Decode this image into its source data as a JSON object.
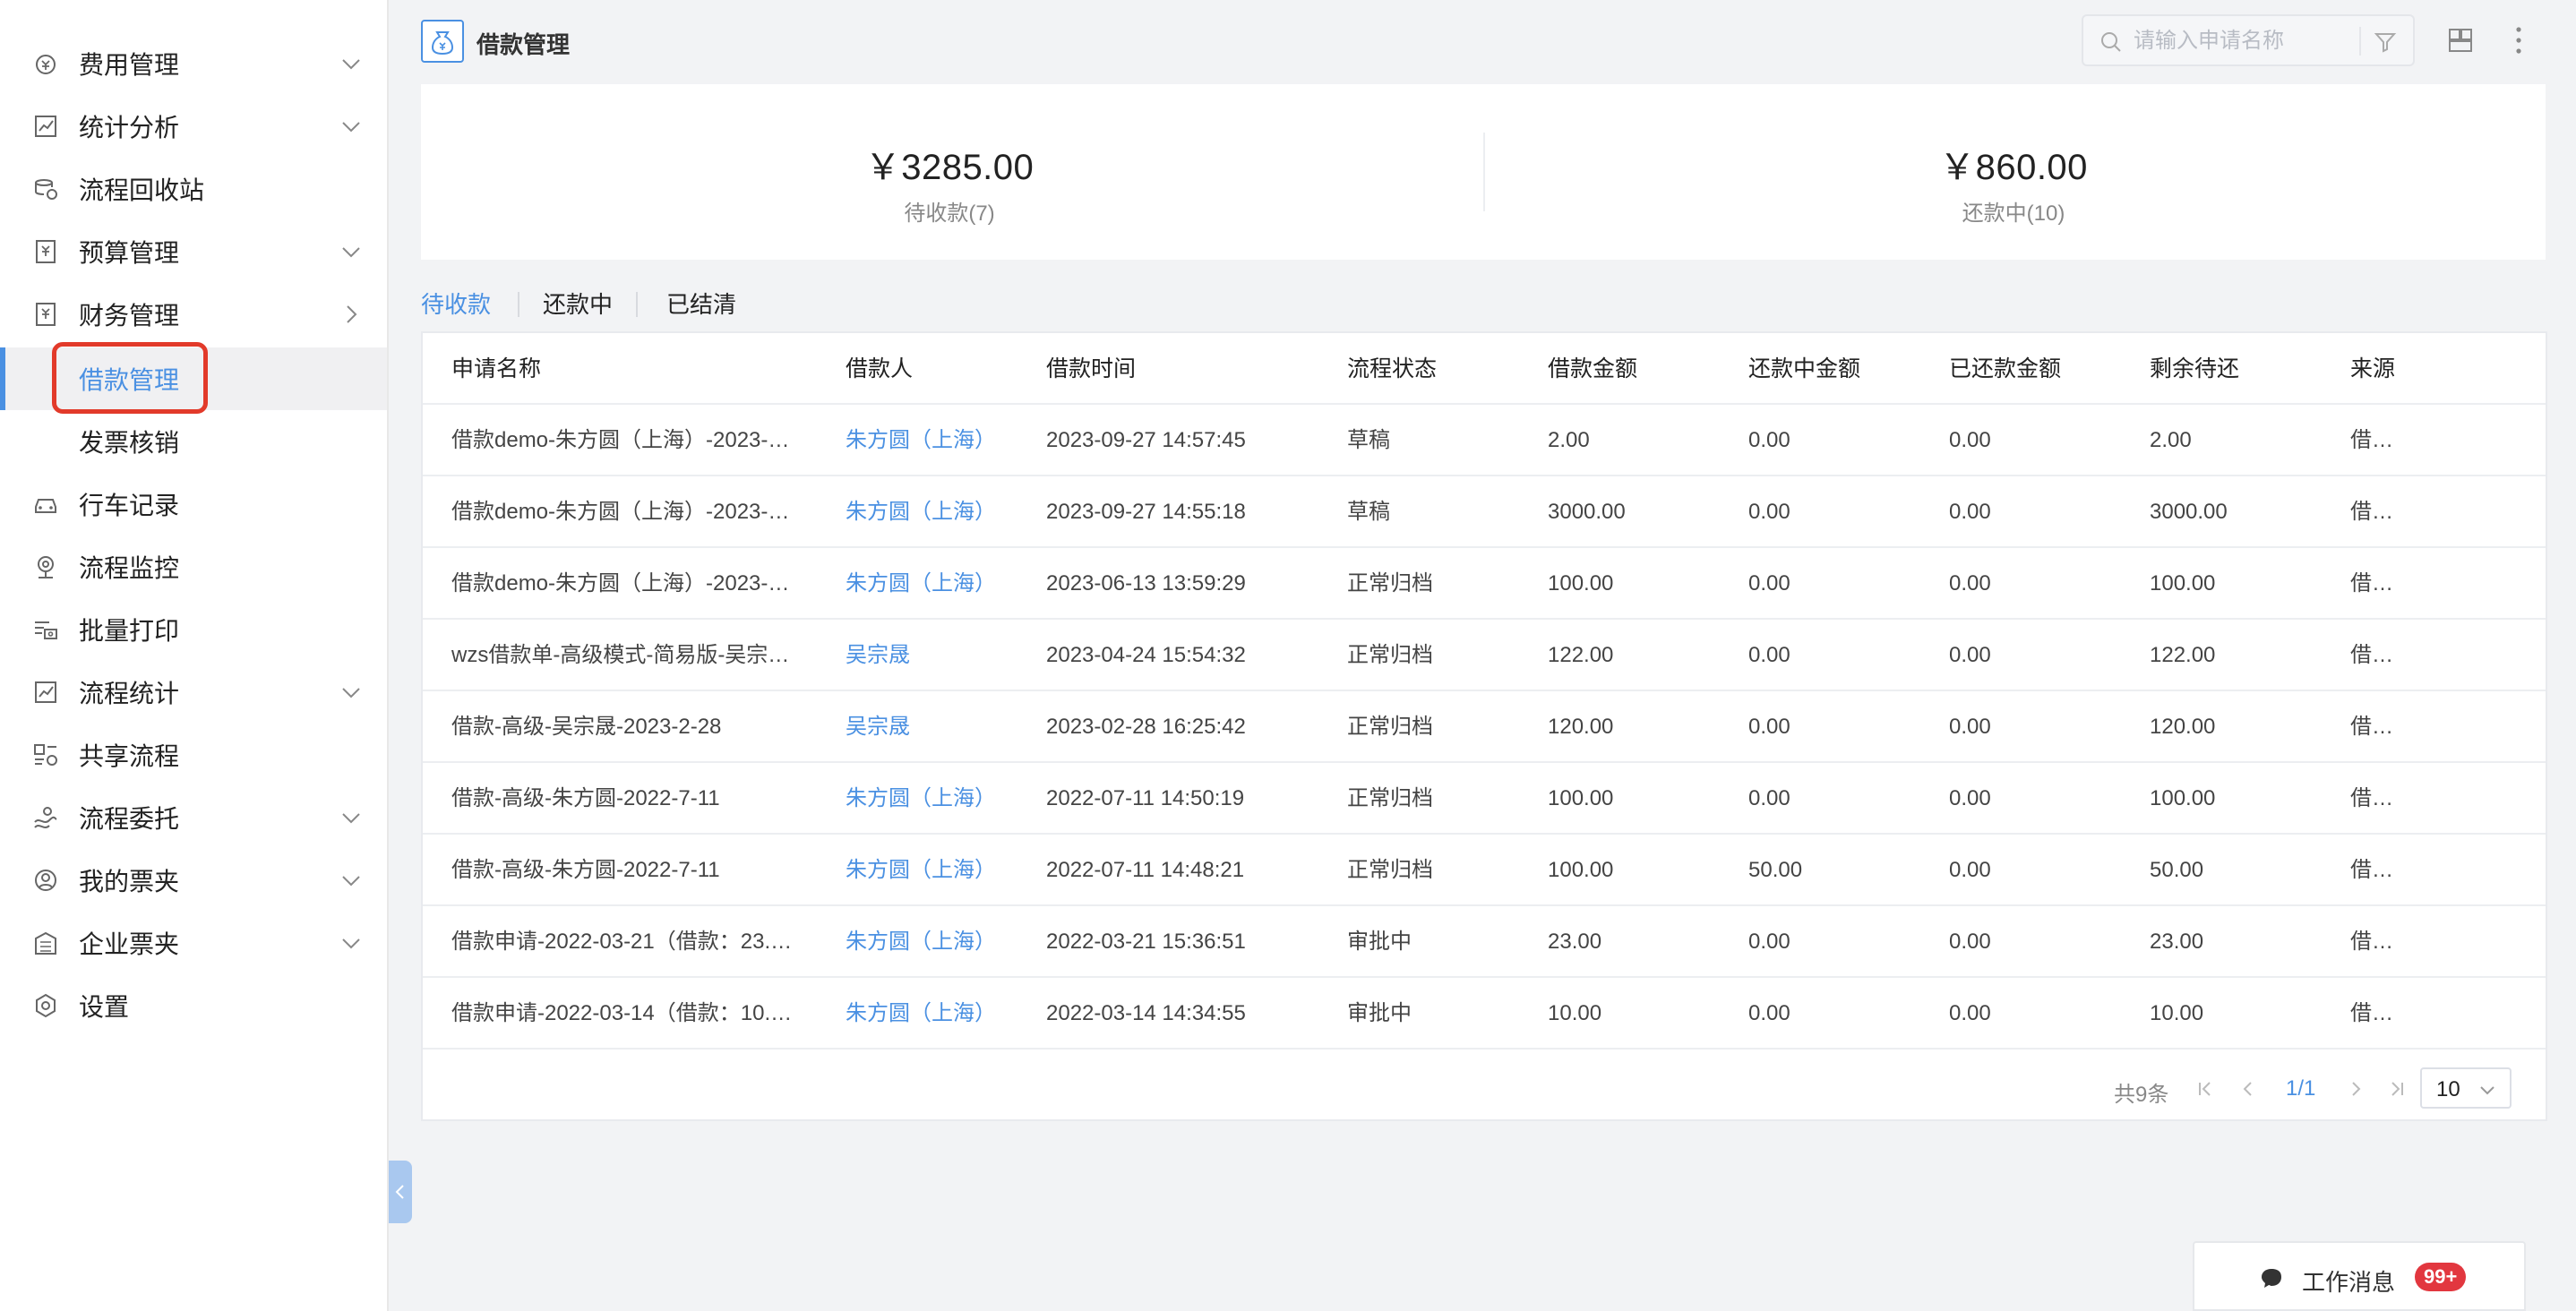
{
  "sidebar": {
    "items": [
      {
        "label": "费用管理",
        "icon": "coin-icon",
        "arrow": "down"
      },
      {
        "label": "统计分析",
        "icon": "chart-icon",
        "arrow": "down"
      },
      {
        "label": "流程回收站",
        "icon": "recycle-icon",
        "arrow": ""
      },
      {
        "label": "预算管理",
        "icon": "budget-icon",
        "arrow": "down"
      },
      {
        "label": "财务管理",
        "icon": "finance-icon",
        "arrow": "right"
      },
      {
        "label": "借款管理",
        "icon": "",
        "arrow": "",
        "active": true
      },
      {
        "label": "发票核销",
        "icon": "",
        "arrow": ""
      },
      {
        "label": "行车记录",
        "icon": "car-icon",
        "arrow": ""
      },
      {
        "label": "流程监控",
        "icon": "monitor-icon",
        "arrow": ""
      },
      {
        "label": "批量打印",
        "icon": "print-icon",
        "arrow": ""
      },
      {
        "label": "流程统计",
        "icon": "stats-icon",
        "arrow": "down"
      },
      {
        "label": "共享流程",
        "icon": "share-icon",
        "arrow": ""
      },
      {
        "label": "流程委托",
        "icon": "delegate-icon",
        "arrow": "down"
      },
      {
        "label": "我的票夹",
        "icon": "user-circle-icon",
        "arrow": "down"
      },
      {
        "label": "企业票夹",
        "icon": "building-icon",
        "arrow": "down"
      },
      {
        "label": "设置",
        "icon": "settings-icon",
        "arrow": ""
      }
    ]
  },
  "header": {
    "title": "借款管理",
    "search_placeholder": "请输入申请名称"
  },
  "summary": {
    "pending": {
      "amount": "￥3285.00",
      "label": "待收款(7)"
    },
    "repaying": {
      "amount": "￥860.00",
      "label": "还款中(10)"
    }
  },
  "tabs": [
    "待收款",
    "还款中",
    "已结清"
  ],
  "table": {
    "headers": [
      "申请名称",
      "借款人",
      "借款时间",
      "流程状态",
      "借款金额",
      "还款中金额",
      "已还款金额",
      "剩余待还",
      "来源"
    ],
    "rows": [
      [
        "借款demo-朱方圆（上海）-2023-…",
        "朱方圆（上海）",
        "2023-09-27 14:57:45",
        "草稿",
        "2.00",
        "0.00",
        "0.00",
        "2.00",
        "借…"
      ],
      [
        "借款demo-朱方圆（上海）-2023-…",
        "朱方圆（上海）",
        "2023-09-27 14:55:18",
        "草稿",
        "3000.00",
        "0.00",
        "0.00",
        "3000.00",
        "借…"
      ],
      [
        "借款demo-朱方圆（上海）-2023-…",
        "朱方圆（上海）",
        "2023-06-13 13:59:29",
        "正常归档",
        "100.00",
        "0.00",
        "0.00",
        "100.00",
        "借…"
      ],
      [
        "wzs借款单-高级模式-简易版-吴宗…",
        "吴宗晟",
        "2023-04-24 15:54:32",
        "正常归档",
        "122.00",
        "0.00",
        "0.00",
        "122.00",
        "借…"
      ],
      [
        "借款-高级-吴宗晟-2023-2-28",
        "吴宗晟",
        "2023-02-28 16:25:42",
        "正常归档",
        "120.00",
        "0.00",
        "0.00",
        "120.00",
        "借…"
      ],
      [
        "借款-高级-朱方圆-2022-7-11",
        "朱方圆（上海）",
        "2022-07-11 14:50:19",
        "正常归档",
        "100.00",
        "0.00",
        "0.00",
        "100.00",
        "借…"
      ],
      [
        "借款-高级-朱方圆-2022-7-11",
        "朱方圆（上海）",
        "2022-07-11 14:48:21",
        "正常归档",
        "100.00",
        "50.00",
        "0.00",
        "50.00",
        "借…"
      ],
      [
        "借款申请-2022-03-21（借款：23.…",
        "朱方圆（上海）",
        "2022-03-21 15:36:51",
        "审批中",
        "23.00",
        "0.00",
        "0.00",
        "23.00",
        "借…"
      ],
      [
        "借款申请-2022-03-14（借款：10.…",
        "朱方圆（上海）",
        "2022-03-14 14:34:55",
        "审批中",
        "10.00",
        "0.00",
        "0.00",
        "10.00",
        "借…"
      ]
    ]
  },
  "pagination": {
    "total": "共9条",
    "page": "1/1",
    "page_size": "10"
  },
  "work_message": {
    "label": "工作消息",
    "badge": "99+"
  },
  "colors": {
    "accent": "#4a90e2",
    "highlight": "#e23a2a",
    "badge": "#e2373f"
  }
}
